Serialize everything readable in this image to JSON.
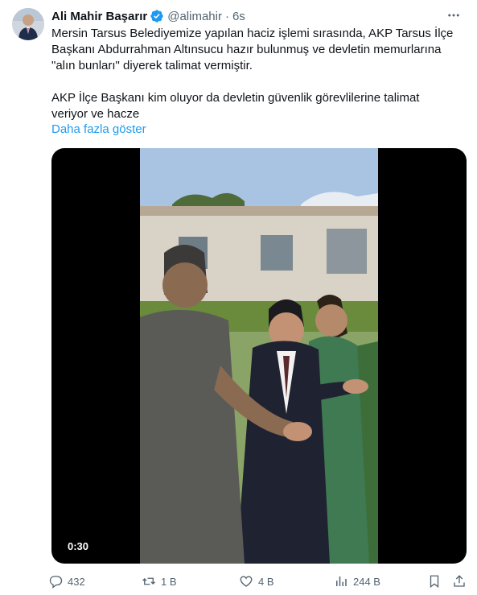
{
  "author": {
    "name": "Ali Mahir Başarır",
    "handle": "@alimahir",
    "separator": "·",
    "time": "6s"
  },
  "tweet": {
    "paragraph1": "Mersin Tarsus Belediyemize yapılan haciz işlemi sırasında, AKP Tarsus İlçe\nBaşkanı Abdurrahman Altınsucu hazır bulunmuş ve devletin memurlarına\n\"alın bunları\" diyerek talimat vermiştir.",
    "paragraph2": "AKP İlçe Başkanı kim oluyor da devletin güvenlik görevlilerine talimat\nveriyor ve hacze",
    "show_more": "Daha fazla göster"
  },
  "video": {
    "duration": "0:30"
  },
  "actions": {
    "replies": "432",
    "reposts": "1 B",
    "likes": "4 B",
    "views": "244 B"
  },
  "colors": {
    "accent": "#1d9bf0",
    "text": "#0f1419",
    "muted": "#536471"
  },
  "icons": [
    "verified-badge-icon",
    "more-icon",
    "reply-icon",
    "repost-icon",
    "like-icon",
    "views-icon",
    "bookmark-icon",
    "share-icon"
  ]
}
